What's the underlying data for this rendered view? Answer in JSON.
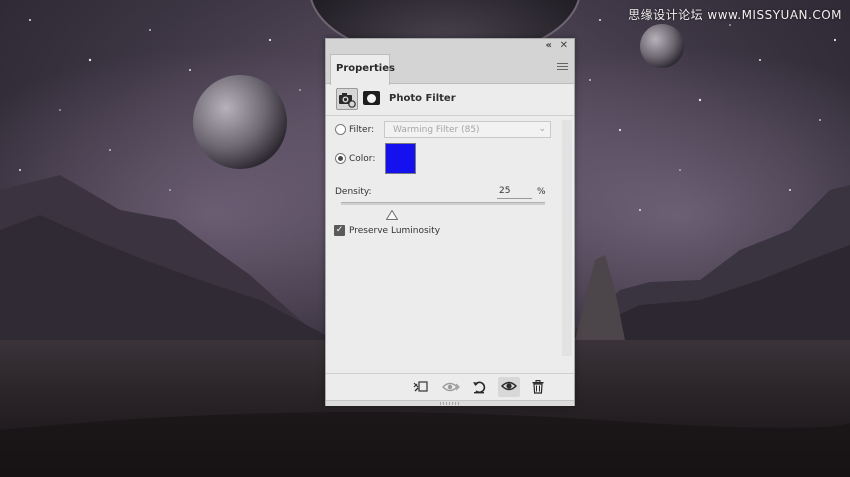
{
  "watermark": {
    "text": "思缘设计论坛 www.MISSYUAN.COM"
  },
  "panel": {
    "tab_label": "Properties",
    "adjustment_title": "Photo Filter",
    "filter": {
      "label": "Filter:",
      "selected": false,
      "value": "Warming Filter (85)"
    },
    "color": {
      "label": "Color:",
      "selected": true,
      "swatch": "#1410ee"
    },
    "density": {
      "label": "Density:",
      "value": "25",
      "unit": "%",
      "level_percent": 25
    },
    "preserve_luminosity": {
      "label": "Preserve Luminosity",
      "checked": true
    },
    "icons": {
      "adjustment": "camera-filter-icon",
      "mask": "layer-mask-icon",
      "clip": "clip-to-layer-icon",
      "view_previous": "view-previous-icon",
      "reset": "reset-icon",
      "visibility": "eye-icon",
      "delete": "trash-icon",
      "collapse": "double-chevron-icon",
      "close": "close-icon",
      "menu": "panel-menu-icon"
    }
  },
  "colors": {
    "panel_bg": "#ececec",
    "sky_dark": "#2b2731",
    "nebula": "#7b6a84"
  }
}
